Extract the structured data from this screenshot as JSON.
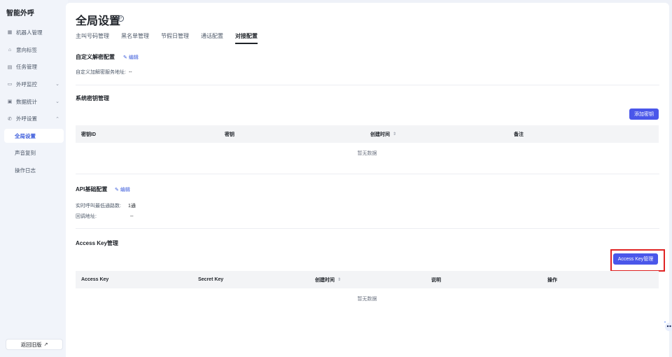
{
  "sidebar": {
    "brand": "智能外呼",
    "items": [
      {
        "label": "机器人管理",
        "icon": "robot-icon"
      },
      {
        "label": "意向标签",
        "icon": "tag-icon"
      },
      {
        "label": "任务管理",
        "icon": "task-icon"
      },
      {
        "label": "外呼监控",
        "icon": "monitor-icon",
        "expandable": true
      },
      {
        "label": "数据统计",
        "icon": "chart-icon",
        "expandable": true
      },
      {
        "label": "外呼设置",
        "icon": "phone-settings-icon",
        "expanded": true
      }
    ],
    "sub_items": [
      {
        "label": "全局设置",
        "active": true
      },
      {
        "label": "声音复刻"
      },
      {
        "label": "操作日志"
      }
    ],
    "back_button": "返回旧版"
  },
  "page": {
    "title": "全局设置",
    "tabs": [
      {
        "label": "主叫号码管理"
      },
      {
        "label": "黑名单管理"
      },
      {
        "label": "节假日管理"
      },
      {
        "label": "通话配置"
      },
      {
        "label": "对接配置",
        "active": true
      }
    ]
  },
  "custom_decrypt": {
    "title": "自定义解密配置",
    "edit_label": "编辑",
    "service_label": "自定义加解密服务地址:",
    "service_value": "--"
  },
  "system_keys": {
    "title": "系统密钥管理",
    "add_button": "添加密钥",
    "columns": [
      "密钥ID",
      "密钥",
      "创建时间",
      "备注"
    ],
    "empty_text": "暂无数据"
  },
  "api_config": {
    "title": "API基础配置",
    "edit_label": "编辑",
    "rows": [
      {
        "label": "实时呼叫最低通路数:",
        "value": "1通"
      },
      {
        "label": "回调地址:",
        "value": "--"
      }
    ]
  },
  "access_keys": {
    "title": "Access Key管理",
    "manage_button": "Access Key管理",
    "columns": [
      "Access Key",
      "Secret Key",
      "创建时间",
      "说明",
      "操作"
    ],
    "empty_text": "暂无数据"
  },
  "colors": {
    "accent": "#4a57ea",
    "highlight": "#e02424",
    "link": "#3b5bdb"
  }
}
